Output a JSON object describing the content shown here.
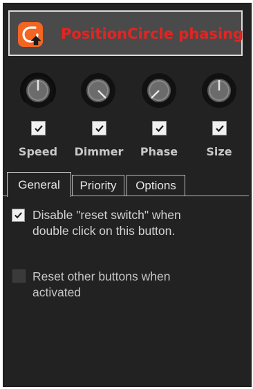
{
  "header": {
    "title": "PositionCircle phasing",
    "icon": "position-circle-icon",
    "accent": "#f26522",
    "title_color": "#e52421"
  },
  "knobs": [
    {
      "label": "Speed",
      "enabled": true
    },
    {
      "label": "Dimmer",
      "enabled": true
    },
    {
      "label": "Phase",
      "enabled": true
    },
    {
      "label": "Size",
      "enabled": true
    }
  ],
  "tabs": [
    {
      "label": "General",
      "active": true
    },
    {
      "label": "Priority",
      "active": false
    },
    {
      "label": "Options",
      "active": false
    }
  ],
  "general": {
    "disable_reset_switch": {
      "line1": "Disable \"reset switch\" when",
      "line2": "double click on this button.",
      "checked": true
    },
    "reset_other_buttons": {
      "line1": "Reset other buttons when",
      "line2": "activated",
      "checked": false
    }
  }
}
